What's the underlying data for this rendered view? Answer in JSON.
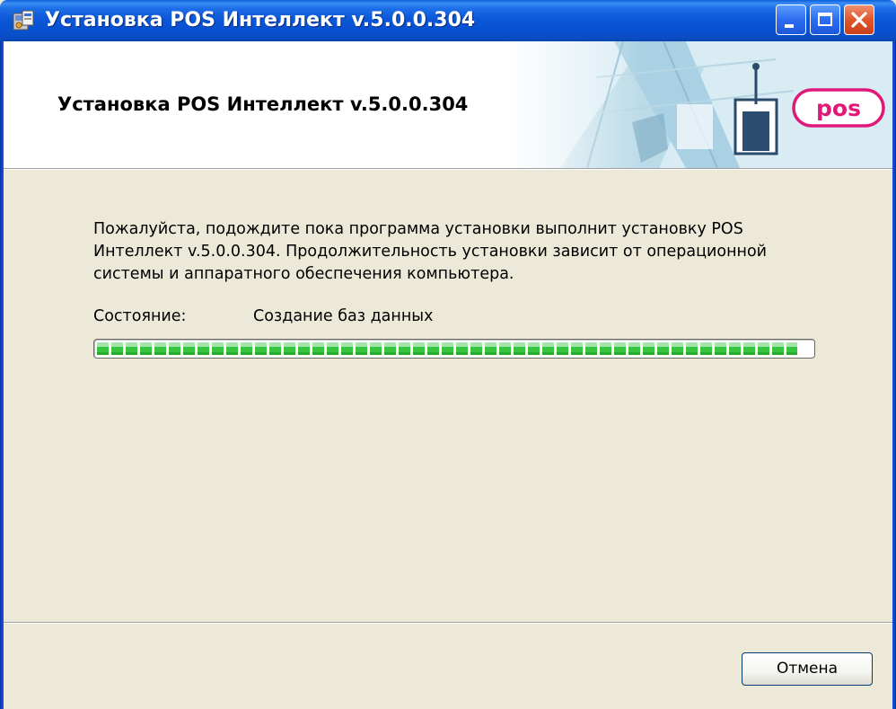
{
  "window": {
    "title": "Установка POS Интеллект v.5.0.0.304"
  },
  "banner": {
    "title": "Установка POS Интеллект v.5.0.0.304",
    "logo_text": "pos"
  },
  "body": {
    "description": "Пожалуйста, подождите пока программа установки выполнит установку POS Интеллект v.5.0.0.304. Продолжительность установки зависит от операционной системы и аппаратного обеспечения компьютера.",
    "status_label": "Состояние:",
    "status_value": "Создание баз данных",
    "progress_percent": 98
  },
  "footer": {
    "cancel_label": "Отмена"
  },
  "colors": {
    "titlebar": "#0a55d4",
    "dialog_bg": "#ece9d8",
    "progress_green": "#37c43f",
    "logo_pink": "#e0187a"
  },
  "icons": {
    "title_icon": "installer-icon",
    "minimize": "minimize-icon",
    "maximize": "maximize-icon",
    "close": "close-icon"
  }
}
